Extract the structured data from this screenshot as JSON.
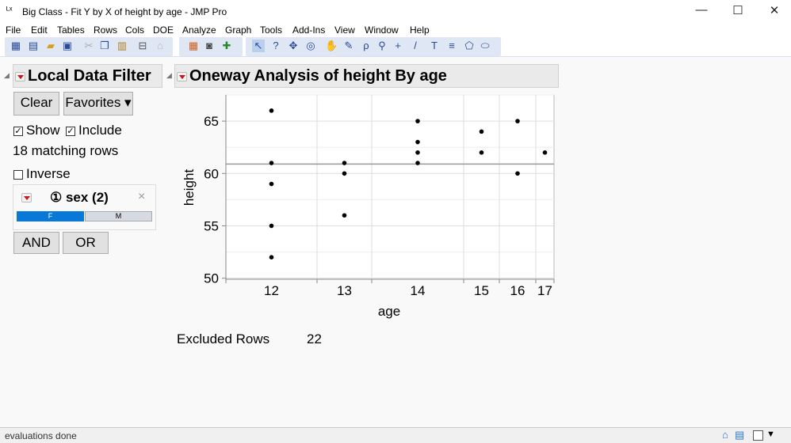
{
  "window": {
    "title": "Big Class - Fit Y by X of height by age - JMP Pro",
    "icon": "jmp-graph-icon",
    "minimize": "—",
    "maximize": "☐",
    "close": "✕"
  },
  "menu": [
    "File",
    "Edit",
    "Tables",
    "Rows",
    "Cols",
    "DOE",
    "Analyze",
    "Graph",
    "Tools",
    "Add-Ins",
    "View",
    "Window",
    "Help"
  ],
  "filter": {
    "title": "Local Data Filter",
    "clear": "Clear",
    "favorites": "Favorites",
    "show": "Show",
    "include": "Include",
    "matching": "18 matching rows",
    "inverse": "Inverse",
    "column_title": "① sex (2)",
    "close": "×",
    "levels": [
      {
        "label": "F",
        "selected": true
      },
      {
        "label": "M",
        "selected": false
      }
    ],
    "and": "AND",
    "or": "OR",
    "accent": "#0a78d7"
  },
  "report": {
    "title": "Oneway Analysis of height By age",
    "excluded_label": "Excluded Rows",
    "excluded_value": "22"
  },
  "chart_data": {
    "type": "scatter",
    "xlabel": "age",
    "ylabel": "height",
    "categories": [
      "12",
      "13",
      "14",
      "15",
      "16",
      "17"
    ],
    "ylim": [
      49.9,
      67.5
    ],
    "yticks": [
      50,
      55,
      60,
      65
    ],
    "grid": true,
    "mean_line": 60.9,
    "points": [
      [
        12,
        66
      ],
      [
        12,
        61
      ],
      [
        12,
        59
      ],
      [
        12,
        55
      ],
      [
        12,
        52
      ],
      [
        13,
        61
      ],
      [
        13,
        60
      ],
      [
        13,
        56
      ],
      [
        14,
        65
      ],
      [
        14,
        63
      ],
      [
        14,
        62
      ],
      [
        14,
        61
      ],
      [
        15,
        64
      ],
      [
        15,
        62
      ],
      [
        16,
        65
      ],
      [
        16,
        60
      ],
      [
        17,
        62
      ]
    ]
  },
  "status": {
    "text": "evaluations done"
  }
}
